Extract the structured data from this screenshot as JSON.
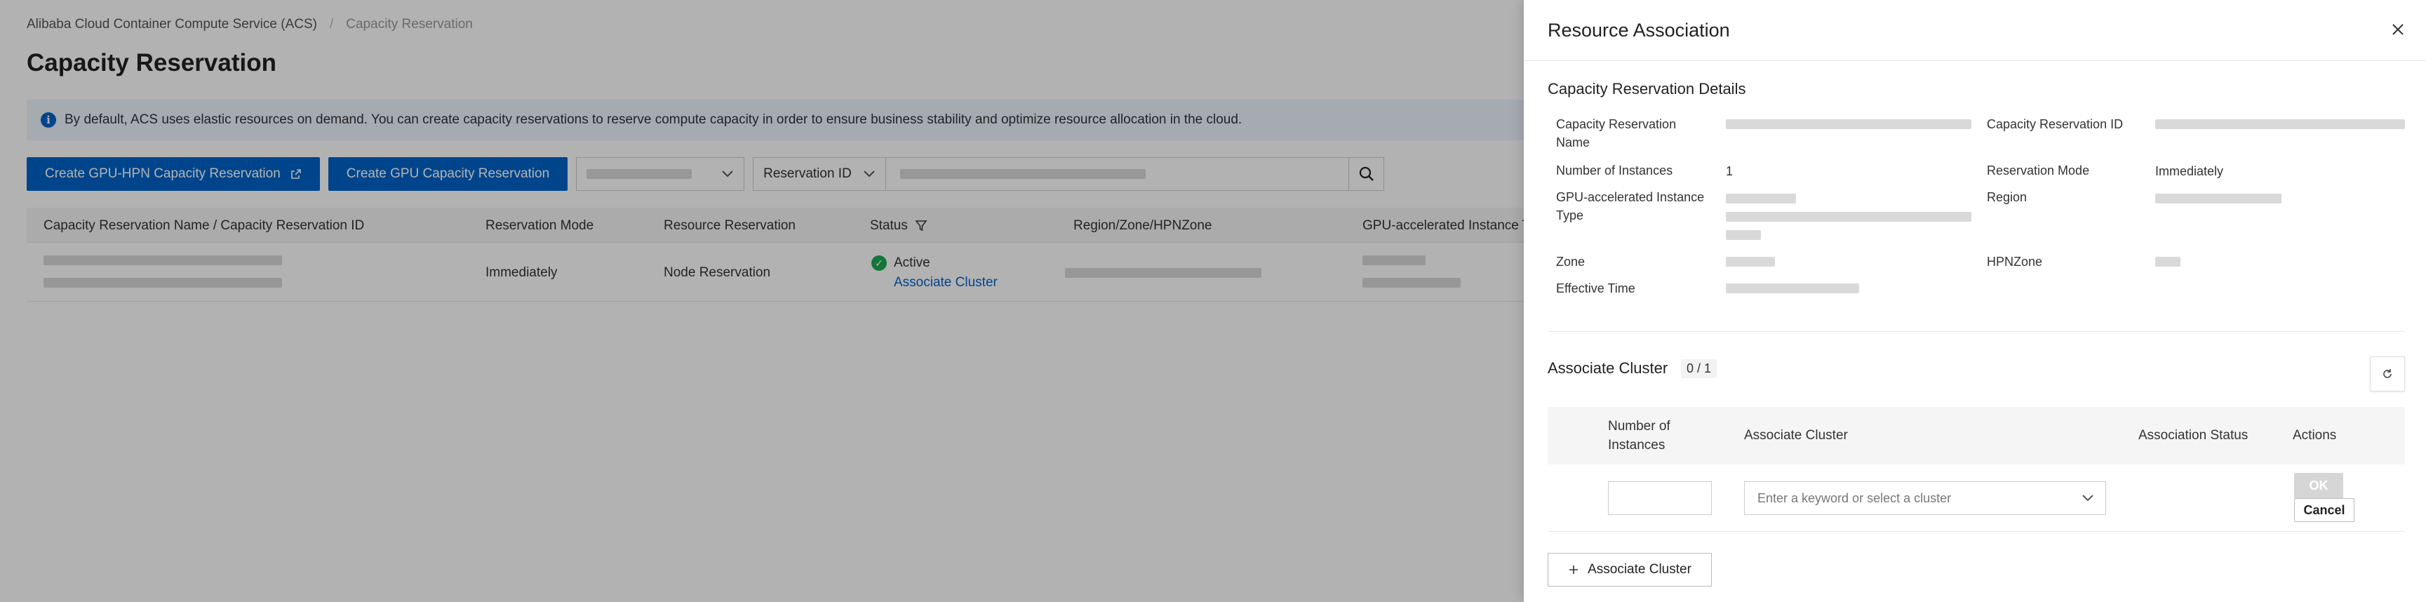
{
  "breadcrumb": {
    "root": "Alibaba Cloud Container Compute Service (ACS)",
    "separator": "/",
    "current": "Capacity Reservation"
  },
  "page": {
    "title": "Capacity Reservation",
    "info": "By default, ACS uses elastic resources on demand. You can create capacity reservations to reserve compute capacity in order to ensure business stability and optimize resource allocation in the cloud."
  },
  "toolbar": {
    "create_hpn_label": "Create GPU-HPN Capacity Reservation",
    "create_gpu_label": "Create GPU Capacity Reservation",
    "search_field_label": "Reservation ID"
  },
  "table": {
    "headers": {
      "name": "Capacity Reservation Name / Capacity Reservation ID",
      "mode": "Reservation Mode",
      "resource": "Resource Reservation",
      "status": "Status",
      "region": "Region/Zone/HPNZone",
      "instance_type": "GPU-accelerated Instance T"
    },
    "rows": [
      {
        "mode": "Immediately",
        "resource": "Node Reservation",
        "status": "Active",
        "action": "Associate Cluster"
      }
    ]
  },
  "drawer": {
    "title": "Resource Association",
    "details_title": "Capacity Reservation Details",
    "labels": {
      "name": "Capacity Reservation Name",
      "id": "Capacity Reservation ID",
      "instances": "Number of Instances",
      "mode": "Reservation Mode",
      "instance_type": "GPU-accelerated Instance Type",
      "region": "Region",
      "zone": "Zone",
      "hpnzone": "HPNZone",
      "effective_time": "Effective Time"
    },
    "values": {
      "instances": "1",
      "mode": "Immediately"
    },
    "assoc": {
      "title": "Associate Cluster",
      "count": "0 / 1",
      "headers": {
        "instances": "Number of Instances",
        "cluster": "Associate Cluster",
        "status": "Association Status",
        "actions": "Actions"
      },
      "cluster_placeholder": "Enter a keyword or select a cluster",
      "ok_label": "OK",
      "cancel_label": "Cancel",
      "add_label": "Associate Cluster"
    }
  },
  "colors": {
    "primary": "#0064c8",
    "success": "#1aaa55",
    "overlay": "rgba(0,0,0,0.30)"
  }
}
